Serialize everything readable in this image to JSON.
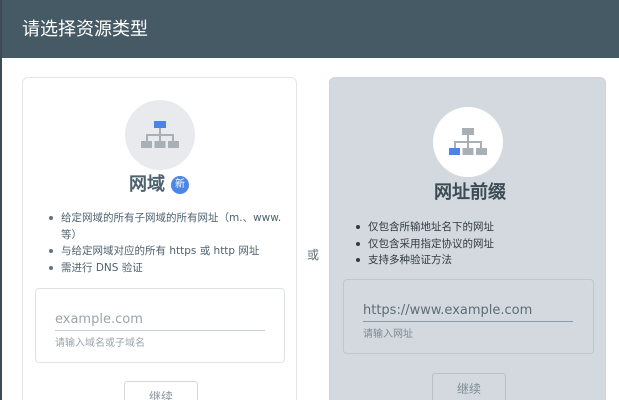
{
  "header": {
    "title": "请选择资源类型"
  },
  "separator": "或",
  "domain_panel": {
    "icon": "network-tree-icon",
    "title": "网域",
    "badge": "新",
    "bullets": [
      "给定网域的所有子网域的所有网址（m.、www. 等）",
      "与给定网域对应的所有 https 或 http 网址",
      "需进行 DNS 验证"
    ],
    "input_placeholder": "example.com",
    "input_value": "",
    "hint": "请输入域名或子域名",
    "button_label": "继续"
  },
  "prefix_panel": {
    "icon": "network-tree-icon",
    "title": "网址前缀",
    "bullets": [
      "仅包含所输地址名下的网址",
      "仅包含采用指定协议的网址",
      "支持多种验证方法"
    ],
    "input_placeholder": "https://www.example.com",
    "input_value": "",
    "hint": "请输入网址",
    "button_label": "继续"
  },
  "colors": {
    "header_bg": "#455a64",
    "accent_blue": "#4a86e8",
    "selected_panel_bg": "#d3d9de"
  }
}
